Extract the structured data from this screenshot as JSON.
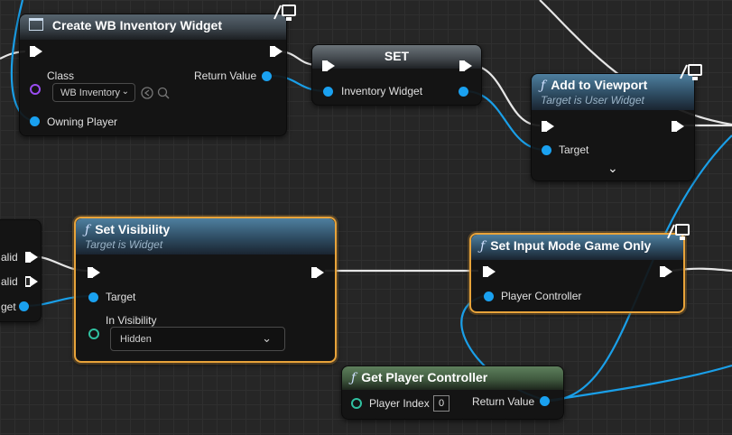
{
  "nodes": {
    "create_widget": {
      "title": "Create WB Inventory Widget",
      "class_label": "Class",
      "class_value": "WB Inventory",
      "return_label": "Return Value",
      "owning_label": "Owning Player"
    },
    "set_node": {
      "title": "SET",
      "var_label": "Inventory Widget"
    },
    "add_to_viewport": {
      "title": "Add to Viewport",
      "subtitle": "Target is User Widget",
      "target_label": "Target"
    },
    "is_valid": {
      "pin1": "alid",
      "pin2": "alid",
      "pin3": "get"
    },
    "set_visibility": {
      "title": "Set Visibility",
      "subtitle": "Target is Widget",
      "target_label": "Target",
      "in_visibility_label": "In Visibility",
      "visibility_value": "Hidden"
    },
    "set_input_mode": {
      "title": "Set Input Mode Game Only",
      "player_controller_label": "Player Controller"
    },
    "get_player_controller": {
      "title": "Get Player Controller",
      "player_index_label": "Player Index",
      "player_index_value": "0",
      "return_label": "Return Value"
    }
  },
  "icons": {
    "function": "ƒ",
    "monitor": "server-only-icon",
    "chevron": "chevron-down-icon"
  },
  "colors": {
    "selection": "#e8a33a",
    "object_pin": "#1aa1f0",
    "exec_pin": "#ffffff",
    "wire_exec": "#ffffff",
    "wire_object": "#1a9fe8"
  }
}
